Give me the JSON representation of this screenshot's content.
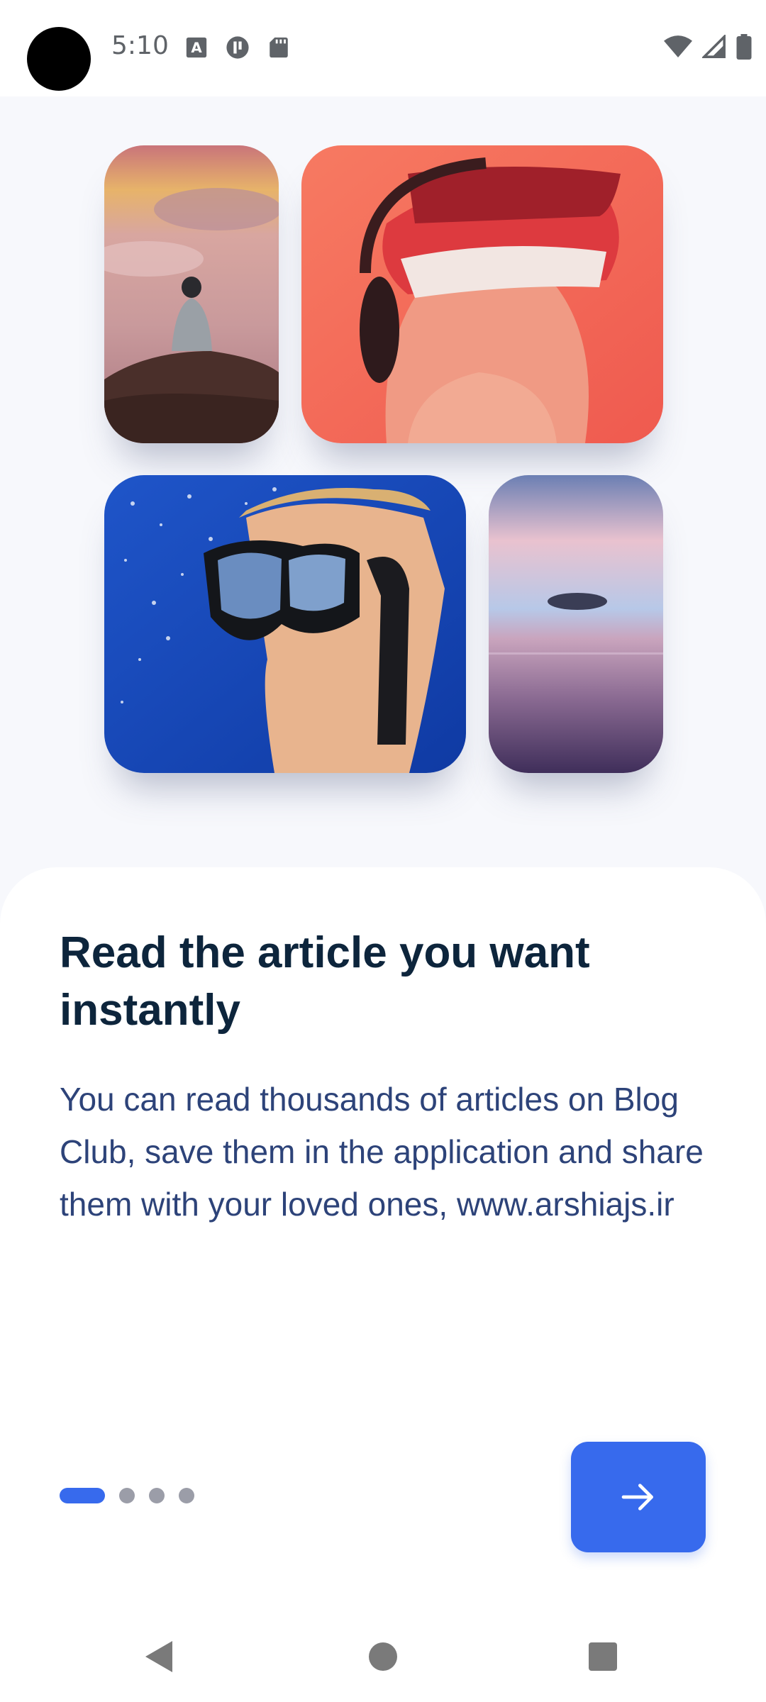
{
  "status_bar": {
    "time": "5:10",
    "left_icons": [
      "text-a-icon",
      "pause-circle-icon",
      "sd-card-icon"
    ],
    "right_icons": [
      "wifi-icon",
      "signal-icon",
      "battery-icon"
    ]
  },
  "images": [
    {
      "name": "mountain-clouds-photo"
    },
    {
      "name": "vr-headset-photo"
    },
    {
      "name": "diver-mask-photo"
    },
    {
      "name": "ocean-sunset-photo"
    }
  ],
  "onboarding": {
    "title": "Read the article you want instantly",
    "description": "You can read thousands of articles on Blog Club, save them in the application and share them with your loved ones, www.arshiajs.ir",
    "page_indicator": {
      "current": 1,
      "total": 4
    },
    "next_icon": "arrow-right-icon"
  },
  "colors": {
    "accent": "#376AED",
    "title": "#0D253C",
    "body": "#2D4379"
  },
  "nav_bar": {
    "icons": [
      "back-icon",
      "home-icon",
      "recents-icon"
    ]
  }
}
